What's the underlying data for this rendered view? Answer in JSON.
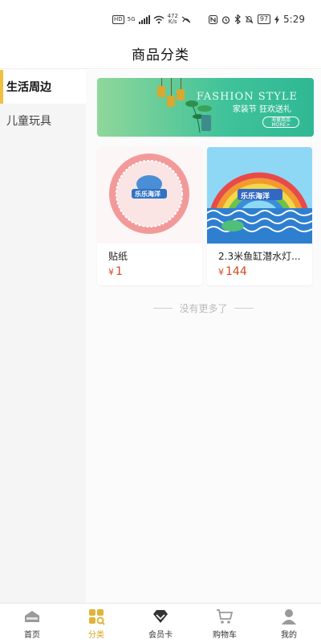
{
  "status_bar": {
    "left": {
      "hd": "HD",
      "net": "5G",
      "speed_value": "472",
      "speed_unit": "K/s"
    },
    "right": {
      "battery": "97",
      "time": "5:29"
    }
  },
  "header": {
    "title": "商品分类"
  },
  "sidebar": {
    "items": [
      {
        "label": "生活周边",
        "active": true
      },
      {
        "label": "儿童玩具",
        "active": false
      }
    ]
  },
  "banner": {
    "title": "FASHION STYLE",
    "subtitle": "家装节 狂欢送礼",
    "tag": "海量商品",
    "button": "MORE>"
  },
  "products": [
    {
      "name": "贴纸",
      "currency": "¥",
      "price": "1",
      "logo_text": "乐乐海洋"
    },
    {
      "name": "2.3米鱼缸潜水灯...",
      "currency": "¥",
      "price": "144",
      "logo_text": "乐乐海洋"
    }
  ],
  "no_more": "没有更多了",
  "tabbar": {
    "items": [
      {
        "label": "首页",
        "icon": "home-icon",
        "active": false
      },
      {
        "label": "分类",
        "icon": "category-icon",
        "active": true
      },
      {
        "label": "会员卡",
        "icon": "diamond-icon",
        "active": false
      },
      {
        "label": "购物车",
        "icon": "cart-icon",
        "active": false
      },
      {
        "label": "我的",
        "icon": "user-icon",
        "active": false
      }
    ]
  },
  "colors": {
    "accent": "#d9a520",
    "price": "#d9471f",
    "sidebar_active_bar": "#f0c040"
  }
}
